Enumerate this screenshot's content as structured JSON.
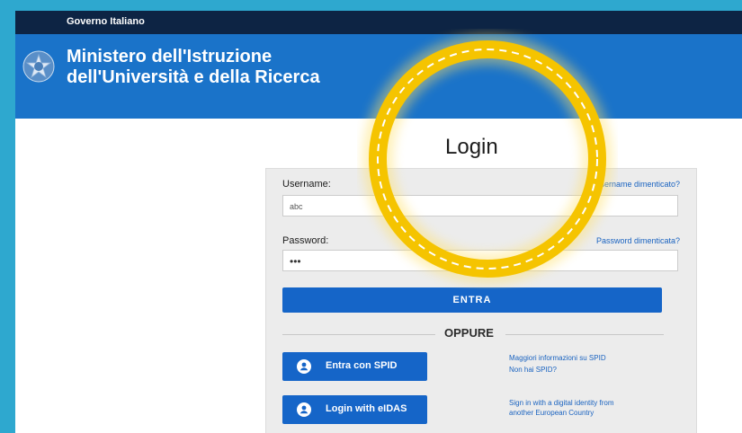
{
  "header": {
    "gov_label": "Governo Italiano",
    "ministry_line1": "Ministero dell'Istruzione",
    "ministry_line2": "dell'Università e della Ricerca"
  },
  "login": {
    "title": "Login",
    "username_label": "Username:",
    "username_forgot": "Username dimenticato?",
    "username_value": "abc",
    "password_label": "Password:",
    "password_forgot": "Password dimenticata?",
    "password_value": "•••",
    "enter_label": "ENTRA",
    "or_label": "OPPURE",
    "spid_button": "Entra con SPID",
    "spid_info_line1": "Maggiori informazioni su SPID",
    "spid_info_line2": "Non hai SPID?",
    "eidas_button": "Login with eIDAS",
    "eidas_info_line1": "Sign in with a digital identity from",
    "eidas_info_line2": "another European Country"
  },
  "colors": {
    "outer_background": "#2ea8cf",
    "gov_bar": "#0d2444",
    "ministry_bar": "#1a73c9",
    "primary_button": "#1565c8",
    "link": "#1a63c0",
    "highlight_ring": "#f5c400"
  },
  "icons": {
    "emblem": "republic-emblem-icon",
    "spid": "user-icon",
    "eidas": "user-icon"
  }
}
